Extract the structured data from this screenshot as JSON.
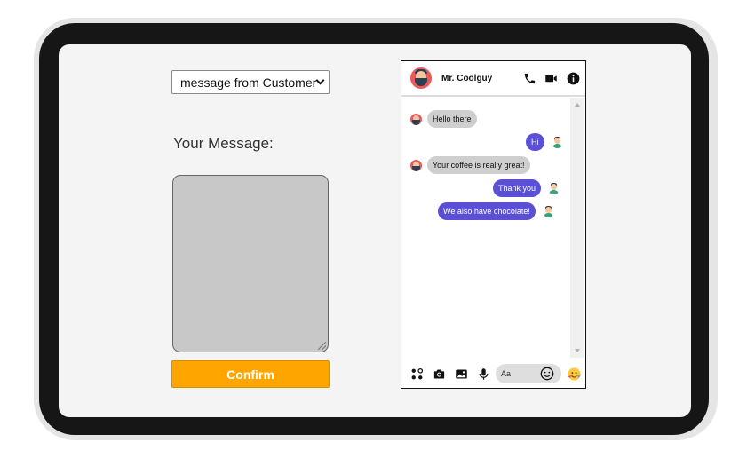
{
  "form": {
    "sender_select": "message from Customer",
    "message_label": "Your Message:",
    "message_value": "",
    "confirm_label": "Confirm"
  },
  "chat": {
    "contact_name": "Mr. Coolguy",
    "composer_placeholder": "Aa",
    "messages": [
      {
        "from": "customer",
        "text": "Hello there"
      },
      {
        "from": "staff",
        "text": "Hi"
      },
      {
        "from": "customer",
        "text": "Your coffee is really great!"
      },
      {
        "from": "staff",
        "text": "Thank you"
      },
      {
        "from": "staff",
        "text": "We also have chocolate!"
      }
    ],
    "header_icons": [
      "phone-icon",
      "video-camera-icon",
      "info-icon"
    ],
    "footer_icons": [
      "apps-icon",
      "camera-icon",
      "image-icon",
      "microphone-icon",
      "emoji-icon",
      "reaction-icon"
    ]
  },
  "colors": {
    "outgoing_bubble": "#5b4fd6",
    "incoming_bubble": "#cfcfcf",
    "confirm_button": "#ffa500",
    "avatar_bg": "#e85b5b"
  }
}
